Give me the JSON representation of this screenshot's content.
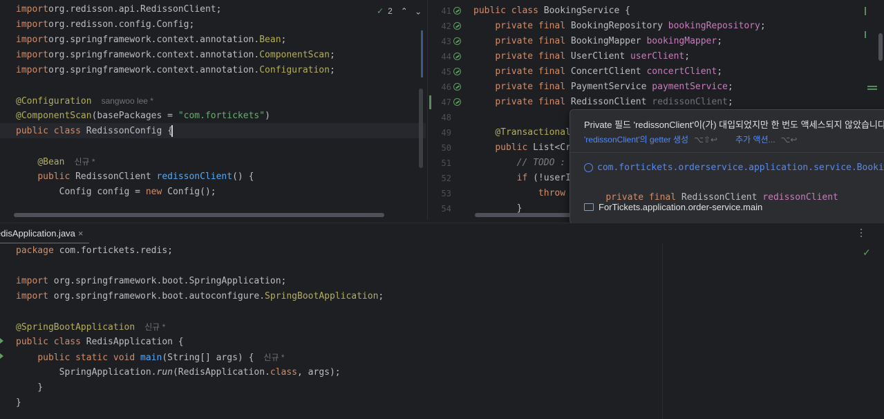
{
  "top_left_editor": {
    "inspection": {
      "count": "2"
    },
    "lines": [
      {
        "parts": [
          [
            "kw",
            "import"
          ],
          [
            "",
            "org.redisson.api.RedissonClient;"
          ]
        ]
      },
      {
        "parts": [
          [
            "kw",
            "import"
          ],
          [
            "",
            "org.redisson.config.Config;"
          ]
        ]
      },
      {
        "parts": [
          [
            "kw",
            "import"
          ],
          [
            "",
            "org.springframework.context.annotation."
          ],
          [
            "ann",
            "Bean"
          ],
          [
            "",
            ";"
          ]
        ]
      },
      {
        "parts": [
          [
            "kw",
            "import"
          ],
          [
            "",
            "org.springframework.context.annotation."
          ],
          [
            "ann",
            "ComponentScan"
          ],
          [
            "",
            ";"
          ]
        ]
      },
      {
        "parts": [
          [
            "kw",
            "import"
          ],
          [
            "",
            "org.springframework.context.annotation."
          ],
          [
            "ann",
            "Configuration"
          ],
          [
            "",
            ";"
          ]
        ]
      },
      {
        "parts": []
      },
      {
        "parts": [
          [
            "ann",
            "@Configuration"
          ]
        ],
        "hint": "sangwoo lee *"
      },
      {
        "parts": [
          [
            "ann",
            "@ComponentScan"
          ],
          [
            "",
            "(basePackages = "
          ],
          [
            "str",
            "\"com."
          ],
          [
            "str",
            "fortickets"
          ],
          [
            "str",
            "\""
          ],
          [
            "",
            ")"
          ]
        ]
      },
      {
        "parts": [
          [
            "kw",
            "public class"
          ],
          [
            "",
            " RedissonConfig {"
          ]
        ]
      },
      {
        "parts": []
      },
      {
        "parts": [
          [
            "",
            "    "
          ],
          [
            "ann",
            "@Bean"
          ]
        ],
        "hint": "신규 *"
      },
      {
        "parts": [
          [
            "",
            "    "
          ],
          [
            "kw",
            "public"
          ],
          [
            "",
            " RedissonClient "
          ],
          [
            "fn",
            "redissonClient"
          ],
          [
            "",
            "() {"
          ]
        ]
      },
      {
        "parts": [
          [
            "",
            "        Config config = "
          ],
          [
            "kw",
            "new"
          ],
          [
            "",
            " Config();"
          ]
        ]
      }
    ]
  },
  "top_right_editor": {
    "line_numbers": [
      "41",
      "42",
      "43",
      "44",
      "45",
      "46",
      "47",
      "48",
      "49",
      "50",
      "51",
      "52",
      "53",
      "54"
    ],
    "lines": [
      {
        "parts": [
          [
            "kw",
            "public class"
          ],
          [
            "",
            " BookingService {"
          ]
        ]
      },
      {
        "parts": [
          [
            "",
            "    "
          ],
          [
            "kw",
            "private final"
          ],
          [
            "",
            " BookingRepository "
          ],
          [
            "fld",
            "bookingRepository"
          ],
          [
            "",
            ";"
          ]
        ]
      },
      {
        "parts": [
          [
            "",
            "    "
          ],
          [
            "kw",
            "private final"
          ],
          [
            "",
            " BookingMapper "
          ],
          [
            "fld",
            "bookingMapper"
          ],
          [
            "",
            ";"
          ]
        ]
      },
      {
        "parts": [
          [
            "",
            "    "
          ],
          [
            "kw",
            "private final"
          ],
          [
            "",
            " UserClient "
          ],
          [
            "fld",
            "userClient"
          ],
          [
            "",
            ";"
          ]
        ]
      },
      {
        "parts": [
          [
            "",
            "    "
          ],
          [
            "kw",
            "private final"
          ],
          [
            "",
            " ConcertClient "
          ],
          [
            "fld",
            "concertClient"
          ],
          [
            "",
            ";"
          ]
        ]
      },
      {
        "parts": [
          [
            "",
            "    "
          ],
          [
            "kw",
            "private final"
          ],
          [
            "",
            " PaymentService "
          ],
          [
            "fld",
            "paymentService"
          ],
          [
            "",
            ";"
          ]
        ]
      },
      {
        "parts": [
          [
            "",
            "    "
          ],
          [
            "kw",
            "private final"
          ],
          [
            "",
            " RedissonClient "
          ],
          [
            "muted",
            "redissonClient"
          ],
          [
            "",
            ";"
          ]
        ]
      },
      {
        "parts": []
      },
      {
        "parts": [
          [
            "",
            "    "
          ],
          [
            "ann",
            "@Transactional"
          ]
        ]
      },
      {
        "parts": [
          [
            "",
            "    "
          ],
          [
            "kw",
            "public"
          ],
          [
            "",
            " List<Cr"
          ]
        ]
      },
      {
        "parts": [
          [
            "",
            "        "
          ],
          [
            "cmt",
            "// TODO :"
          ]
        ]
      },
      {
        "parts": [
          [
            "",
            "        "
          ],
          [
            "kw",
            "if"
          ],
          [
            "",
            " (!userI"
          ]
        ]
      },
      {
        "parts": [
          [
            "",
            "            "
          ],
          [
            "kw",
            "throw"
          ]
        ]
      },
      {
        "parts": [
          [
            "",
            "        }"
          ]
        ]
      }
    ]
  },
  "popup": {
    "message": "Private 필드 'redissonClient'이(가) 대입되었지만 한 번도 액세스되지 않았습니다",
    "action_getter": "'redissonClient'의 getter 생성",
    "action_getter_shortcut": "⌥⇧↩",
    "action_more": "추가 액션...",
    "action_more_shortcut": "⌥↩",
    "class_path": "com.fortickets.orderservice.application.service.BookingService",
    "declaration": {
      "mod": "private final",
      "type": "RedissonClient",
      "name": "redissonClient"
    },
    "module": "ForTickets.application.order-service.main"
  },
  "bottom_tab": {
    "label": "edisApplication.java",
    "close": "×"
  },
  "bottom_editor": {
    "lines": [
      {
        "parts": [
          [
            "kw",
            "package"
          ],
          [
            "",
            " com.fortickets.redis;"
          ]
        ]
      },
      {
        "parts": []
      },
      {
        "parts": [
          [
            "kw",
            "import"
          ],
          [
            "",
            " org.springframework.boot.SpringApplication;"
          ]
        ]
      },
      {
        "parts": [
          [
            "kw",
            "import"
          ],
          [
            "",
            " org.springframework.boot.autoconfigure."
          ],
          [
            "ann",
            "SpringBootApplication"
          ],
          [
            "",
            ";"
          ]
        ]
      },
      {
        "parts": []
      },
      {
        "parts": [
          [
            "ann",
            "@SpringBootApplication"
          ]
        ],
        "hint": "신규 *"
      },
      {
        "parts": [
          [
            "kw",
            "public class"
          ],
          [
            "",
            " RedisApplication {"
          ]
        ]
      },
      {
        "parts": [
          [
            "",
            "    "
          ],
          [
            "kw",
            "public static void"
          ],
          [
            " ",
            " "
          ],
          [
            "fn",
            "main"
          ],
          [
            "",
            "(String[] args) {"
          ]
        ],
        "hint": "신규 *"
      },
      {
        "parts": [
          [
            "",
            "        SpringApplication."
          ],
          [
            "it",
            "run"
          ],
          [
            "",
            "(RedisApplication."
          ],
          [
            "kw",
            "class"
          ],
          [
            "",
            ", args);"
          ]
        ]
      },
      {
        "parts": [
          [
            "",
            "    }"
          ]
        ]
      },
      {
        "parts": [
          [
            "",
            "}"
          ]
        ]
      }
    ]
  },
  "colors": {
    "editor_bg": "#1e1f22",
    "popup_bg": "#2b2d30",
    "accent_link": "#548af7"
  }
}
